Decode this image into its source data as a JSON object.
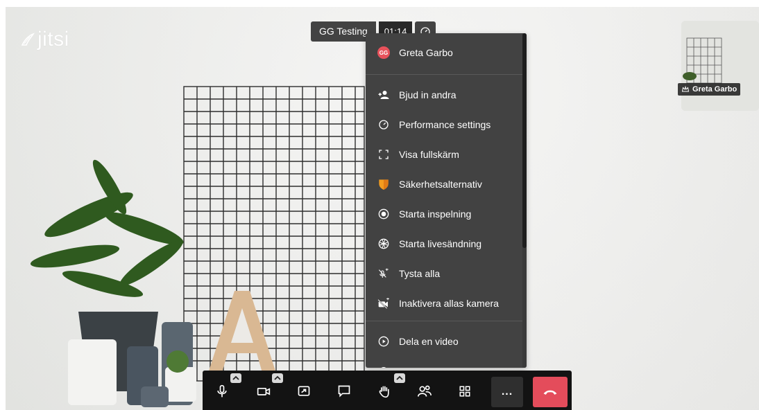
{
  "app": {
    "brand": "jitsi"
  },
  "header": {
    "meeting_name": "GG Testing",
    "timer": "01:14",
    "performance_icon": "gauge-icon"
  },
  "self_view": {
    "name": "Greta Garbo",
    "icon": "crown-icon"
  },
  "menu": {
    "profile": {
      "initials": "GG",
      "name": "Greta Garbo",
      "avatar_color": "#e8525b"
    },
    "items": [
      {
        "label": "Bjud in andra",
        "icon": "add-person-icon"
      },
      {
        "label": "Performance settings",
        "icon": "gauge-icon"
      },
      {
        "label": "Visa fullskärm",
        "icon": "fullscreen-icon"
      },
      {
        "label": "Säkerhetsalternativ",
        "icon": "shield-icon"
      },
      {
        "label": "Starta inspelning",
        "icon": "record-icon"
      },
      {
        "label": "Starta livesändning",
        "icon": "live-stream-icon"
      },
      {
        "label": "Tysta alla",
        "icon": "mute-all-icon"
      },
      {
        "label": "Inaktivera allas kamera",
        "icon": "camera-off-icon"
      },
      {
        "label": "Dela en video",
        "icon": "play-circle-icon"
      }
    ]
  },
  "toolbar": {
    "buttons": [
      {
        "name": "microphone",
        "icon": "microphone-icon"
      },
      {
        "name": "camera",
        "icon": "camera-icon"
      },
      {
        "name": "share-screen",
        "icon": "share-screen-icon"
      },
      {
        "name": "chat",
        "icon": "chat-icon"
      },
      {
        "name": "raise-hand",
        "icon": "hand-icon"
      },
      {
        "name": "participants",
        "icon": "participants-icon"
      },
      {
        "name": "tile-view",
        "icon": "tile-view-icon"
      },
      {
        "name": "more-actions",
        "icon": "more-icon",
        "label": "..."
      },
      {
        "name": "hangup",
        "icon": "hangup-icon"
      }
    ],
    "colors": {
      "bar": "#131313",
      "hangup": "#e44c5b"
    }
  }
}
